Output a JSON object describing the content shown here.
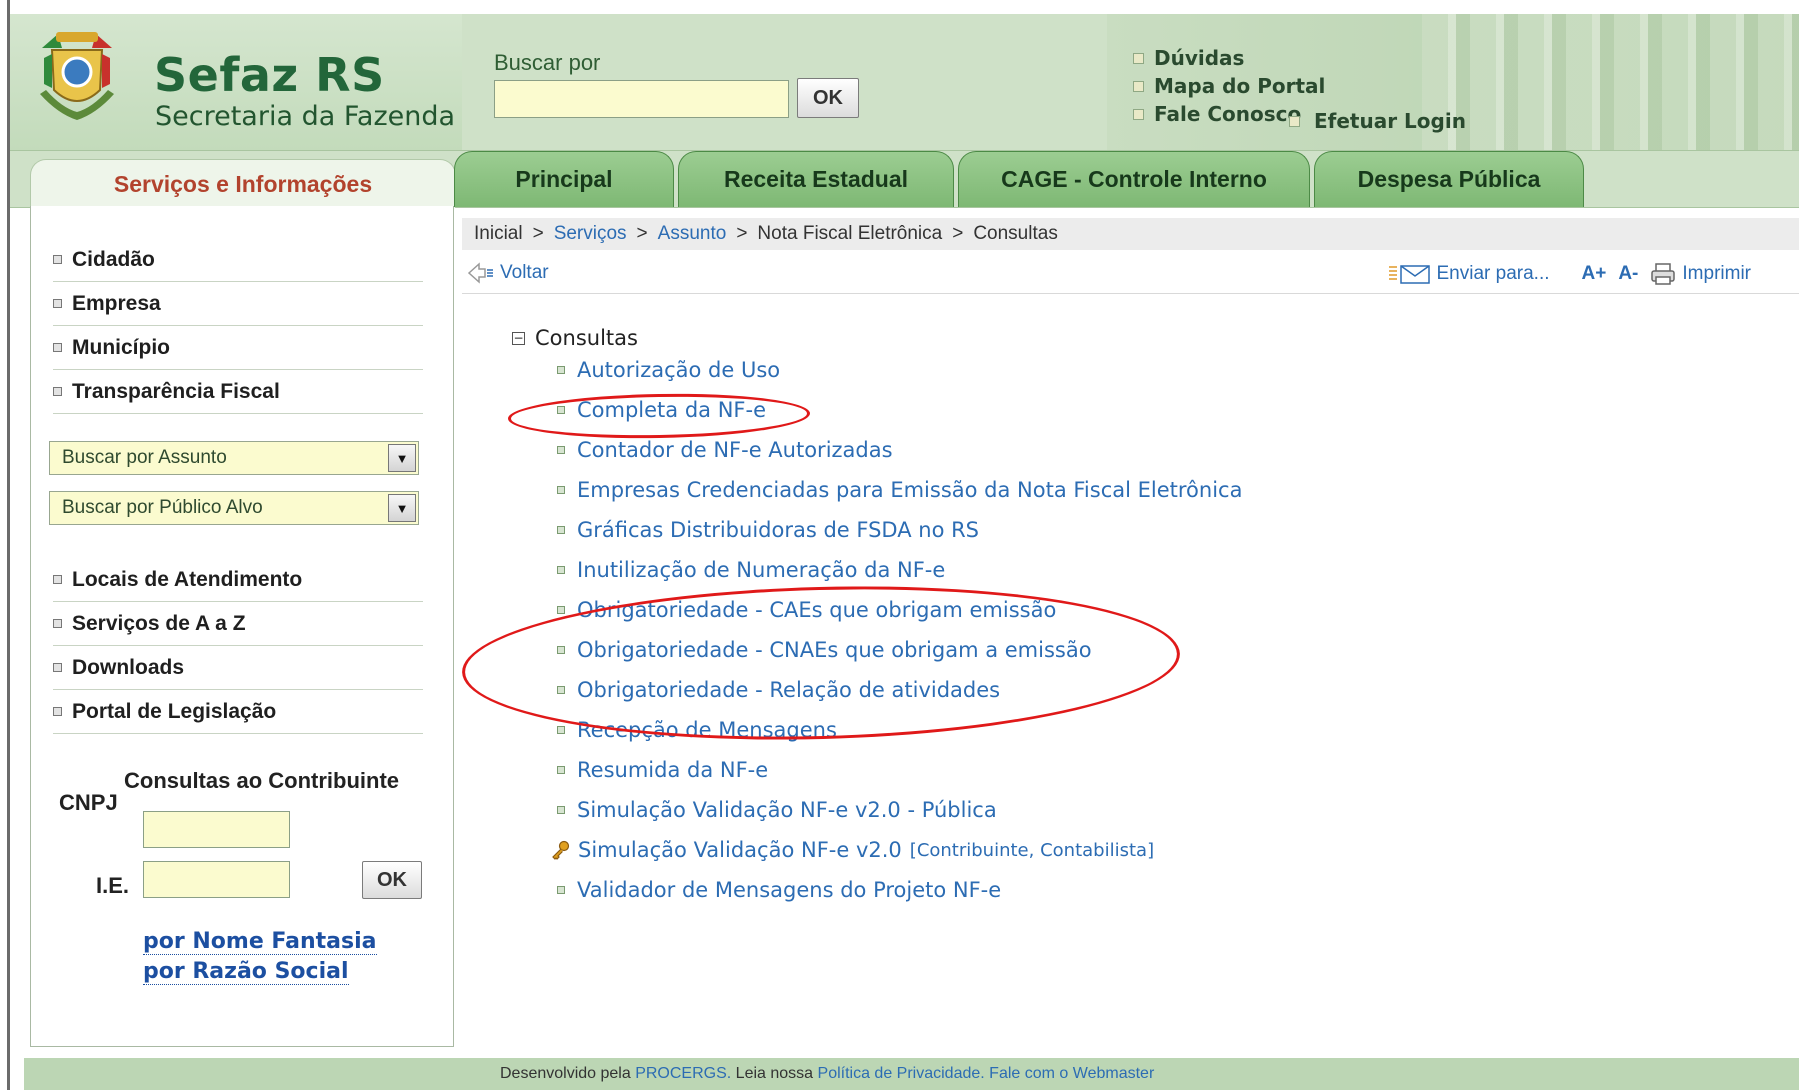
{
  "header": {
    "brand_title": "Sefaz RS",
    "brand_subtitle": "Secretaria da Fazenda",
    "search_label": "Buscar por",
    "search_value": "",
    "search_button": "OK",
    "links": [
      "Dúvidas",
      "Mapa do Portal",
      "Fale Conosco"
    ],
    "login": "Efetuar Login"
  },
  "tabs": {
    "sidebar_tab": "Serviços e Informações",
    "items": [
      "Principal",
      "Receita Estadual",
      "CAGE - Controle Interno",
      "Despesa Pública"
    ]
  },
  "sidebar": {
    "items_top": [
      "Cidadão",
      "Empresa",
      "Município",
      "Transparência Fiscal"
    ],
    "select_assunto": "Buscar por Assunto",
    "select_publico": "Buscar por Público Alvo",
    "items_bottom": [
      "Locais de Atendimento",
      "Serviços de A a Z",
      "Downloads",
      "Portal de Legislação"
    ],
    "consult_title": "Consultas ao Contribuinte",
    "cnpj_label": "CNPJ",
    "ie_label": "I.E.",
    "ok_button": "OK",
    "link_fantasia": "por Nome Fantasia",
    "link_razao": "por Razão Social"
  },
  "breadcrumb": {
    "inicial": "Inicial",
    "servicos": "Serviços",
    "assunto": "Assunto",
    "nfe": "Nota Fiscal Eletrônica",
    "consultas": "Consultas",
    "separator": ">"
  },
  "actions": {
    "voltar": "Voltar",
    "enviar": "Enviar para...",
    "font_up": "A+",
    "font_down": "A-",
    "imprimir": "Imprimir"
  },
  "tree": {
    "root": "Consultas",
    "items": [
      "Autorização de Uso",
      "Completa da NF-e",
      "Contador de NF-e Autorizadas",
      "Empresas Credenciadas para Emissão da Nota Fiscal Eletrônica",
      "Gráficas Distribuidoras de FSDA no RS",
      "Inutilização de Numeração da NF-e",
      "Obrigatoriedade - CAEs que obrigam emissão",
      "Obrigatoriedade - CNAEs que obrigam a emissão",
      "Obrigatoriedade - Relação de atividades",
      "Recepção de Mensagens",
      "Resumida da NF-e",
      "Simulação Validação NF-e v2.0 - Pública",
      "Simulação Validação NF-e v2.0",
      "Validador de Mensagens do Projeto NF-e"
    ],
    "restricted_bracket_open": "[",
    "restricted_roles": "Contribuinte, Contabilista",
    "restricted_bracket_close": "]"
  },
  "footer": {
    "prefix": "Desenvolvido pela",
    "procergs": "PROCERGS.",
    "leia": "Leia nossa",
    "politica": "Política de Privacidade.",
    "fale": "Fale com o Webmaster"
  },
  "colors": {
    "header_green": "#bcd6b4",
    "brand_green": "#23663a",
    "tab_green": "#8cc382",
    "link_blue": "#2c6cb3",
    "highlight_red": "#e01919",
    "input_yellow": "#fbfbcf"
  },
  "icons": [
    "coat-of-arms-icon",
    "back-arrow-icon",
    "envelope-icon",
    "printer-icon",
    "key-icon",
    "collapse-icon",
    "dropdown-arrow-icon"
  ]
}
